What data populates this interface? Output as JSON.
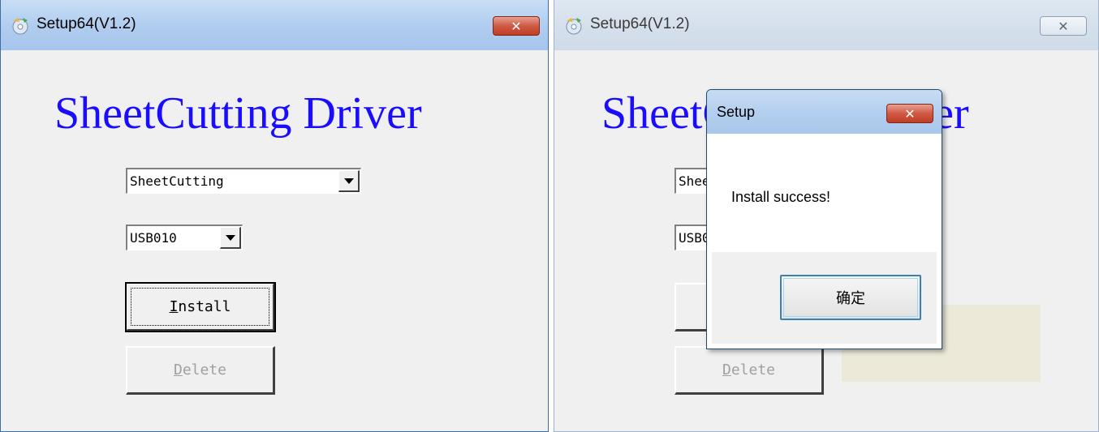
{
  "windows": [
    {
      "title": "Setup64(V1.2)",
      "headline": "SheetCutting Driver",
      "driver_combo": {
        "value": "SheetCutting"
      },
      "port_combo": {
        "value": "USB010"
      },
      "install_button": {
        "mnemonic": "I",
        "rest": "nstall"
      },
      "delete_button": {
        "mnemonic": "D",
        "rest": "elete"
      }
    },
    {
      "title": "Setup64(V1.2)",
      "headline": "SheetCutting Driver",
      "driver_combo": {
        "value": "SheetCutting"
      },
      "port_combo": {
        "value": "USB010"
      },
      "delete_button": {
        "mnemonic": "D",
        "rest": "elete"
      }
    }
  ],
  "dialog": {
    "title": "Setup",
    "message": "Install success!",
    "ok_label": "确定"
  },
  "icons": {
    "app": "setup-app-icon",
    "close": "close-icon",
    "dropdown": "chevron-down-icon"
  },
  "colors": {
    "headline": "#1a0dff",
    "close_active": "#c13d25",
    "titlebar_active": "#b1cdef",
    "titlebar_inactive": "#d5e0ec"
  }
}
